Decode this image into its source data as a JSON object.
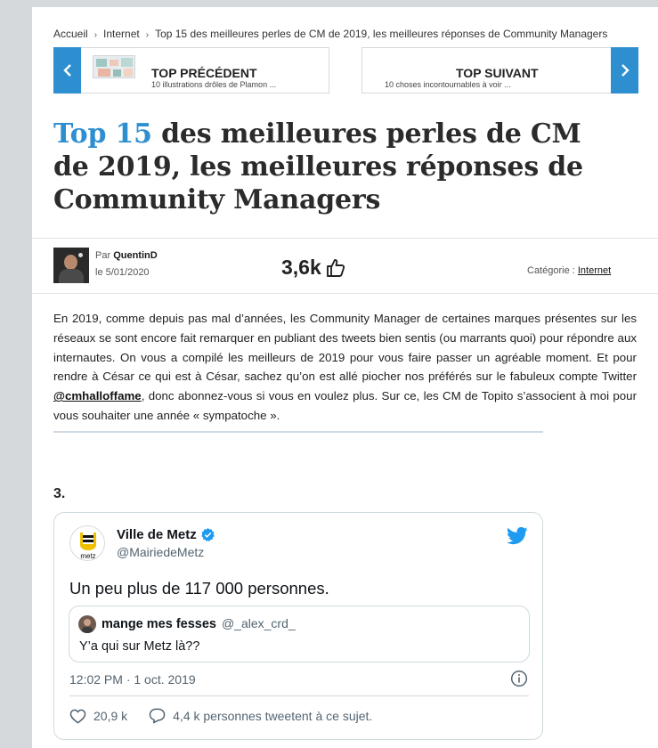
{
  "breadcrumb": {
    "home": "Accueil",
    "section": "Internet",
    "current": "Top 15 des meilleures perles de CM de 2019, les meilleures réponses de Community Managers",
    "separator": "›"
  },
  "nav": {
    "prev": {
      "title": "TOP PRÉCÉDENT",
      "subtitle": "10 illustrations drôles de Plamon ...",
      "icon": "chevron-left-icon"
    },
    "next": {
      "title": "TOP SUIVANT",
      "subtitle": "10 choses incontournables à voir ...",
      "icon": "chevron-right-icon"
    }
  },
  "article": {
    "title_accent": "Top 15",
    "title_rest": " des meilleures perles de CM de 2019, les meilleures réponses de Community Managers",
    "author_prefix": "Par",
    "author": "QuentinD",
    "date": "le 5/01/2020",
    "likes": "3,6k",
    "category_label": "Catégorie :",
    "category": "Internet",
    "intro_part1": "En 2019, comme depuis pas mal d’années, les Community Manager de certaines marques présentes sur les réseaux se sont encore fait remarquer en publiant des tweets bien sentis (ou marrants quoi) pour répondre aux internautes. On vous a compilé les meilleurs de 2019 pour vous faire passer un agréable moment. Et pour rendre à César ce qui est à César, sachez qu’on est allé piocher nos préférés sur le fabuleux compte Twitter ",
    "intro_link": "@cmhalloffame",
    "intro_part2": ", donc abonnez-vous si vous en voulez plus. Sur ce, les CM de Topito s’associent à moi pour vous souhaiter une année « sympatoche »."
  },
  "item_number": "3.",
  "tweet": {
    "name": "Ville de Metz",
    "handle": "@MairiedeMetz",
    "avatar_text": "metz",
    "text": "Un peu plus de 117 000 personnes.",
    "quote": {
      "name": "mange mes fesses",
      "handle": "@_alex_crd_",
      "text": "Y’a qui sur Metz là??"
    },
    "time": "12:02 PM · 1 oct. 2019",
    "likes": "20,9 k",
    "replies": "4,4 k personnes tweetent à ce sujet."
  },
  "colors": {
    "accent": "#2e8fd0",
    "twitter_blue": "#1d9bf0",
    "verified": "#1d9bf0"
  }
}
